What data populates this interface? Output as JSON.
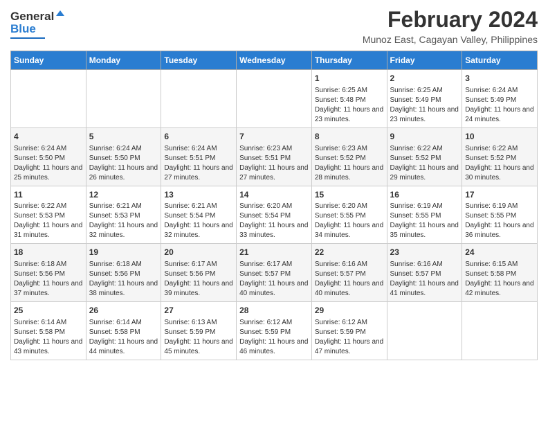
{
  "logo": {
    "general": "General",
    "blue": "Blue"
  },
  "title": "February 2024",
  "subtitle": "Munoz East, Cagayan Valley, Philippines",
  "headers": [
    "Sunday",
    "Monday",
    "Tuesday",
    "Wednesday",
    "Thursday",
    "Friday",
    "Saturday"
  ],
  "weeks": [
    [
      {
        "day": "",
        "detail": ""
      },
      {
        "day": "",
        "detail": ""
      },
      {
        "day": "",
        "detail": ""
      },
      {
        "day": "",
        "detail": ""
      },
      {
        "day": "1",
        "detail": "Sunrise: 6:25 AM\nSunset: 5:48 PM\nDaylight: 11 hours and 23 minutes."
      },
      {
        "day": "2",
        "detail": "Sunrise: 6:25 AM\nSunset: 5:49 PM\nDaylight: 11 hours and 23 minutes."
      },
      {
        "day": "3",
        "detail": "Sunrise: 6:24 AM\nSunset: 5:49 PM\nDaylight: 11 hours and 24 minutes."
      }
    ],
    [
      {
        "day": "4",
        "detail": "Sunrise: 6:24 AM\nSunset: 5:50 PM\nDaylight: 11 hours and 25 minutes."
      },
      {
        "day": "5",
        "detail": "Sunrise: 6:24 AM\nSunset: 5:50 PM\nDaylight: 11 hours and 26 minutes."
      },
      {
        "day": "6",
        "detail": "Sunrise: 6:24 AM\nSunset: 5:51 PM\nDaylight: 11 hours and 27 minutes."
      },
      {
        "day": "7",
        "detail": "Sunrise: 6:23 AM\nSunset: 5:51 PM\nDaylight: 11 hours and 27 minutes."
      },
      {
        "day": "8",
        "detail": "Sunrise: 6:23 AM\nSunset: 5:52 PM\nDaylight: 11 hours and 28 minutes."
      },
      {
        "day": "9",
        "detail": "Sunrise: 6:22 AM\nSunset: 5:52 PM\nDaylight: 11 hours and 29 minutes."
      },
      {
        "day": "10",
        "detail": "Sunrise: 6:22 AM\nSunset: 5:52 PM\nDaylight: 11 hours and 30 minutes."
      }
    ],
    [
      {
        "day": "11",
        "detail": "Sunrise: 6:22 AM\nSunset: 5:53 PM\nDaylight: 11 hours and 31 minutes."
      },
      {
        "day": "12",
        "detail": "Sunrise: 6:21 AM\nSunset: 5:53 PM\nDaylight: 11 hours and 32 minutes."
      },
      {
        "day": "13",
        "detail": "Sunrise: 6:21 AM\nSunset: 5:54 PM\nDaylight: 11 hours and 32 minutes."
      },
      {
        "day": "14",
        "detail": "Sunrise: 6:20 AM\nSunset: 5:54 PM\nDaylight: 11 hours and 33 minutes."
      },
      {
        "day": "15",
        "detail": "Sunrise: 6:20 AM\nSunset: 5:55 PM\nDaylight: 11 hours and 34 minutes."
      },
      {
        "day": "16",
        "detail": "Sunrise: 6:19 AM\nSunset: 5:55 PM\nDaylight: 11 hours and 35 minutes."
      },
      {
        "day": "17",
        "detail": "Sunrise: 6:19 AM\nSunset: 5:55 PM\nDaylight: 11 hours and 36 minutes."
      }
    ],
    [
      {
        "day": "18",
        "detail": "Sunrise: 6:18 AM\nSunset: 5:56 PM\nDaylight: 11 hours and 37 minutes."
      },
      {
        "day": "19",
        "detail": "Sunrise: 6:18 AM\nSunset: 5:56 PM\nDaylight: 11 hours and 38 minutes."
      },
      {
        "day": "20",
        "detail": "Sunrise: 6:17 AM\nSunset: 5:56 PM\nDaylight: 11 hours and 39 minutes."
      },
      {
        "day": "21",
        "detail": "Sunrise: 6:17 AM\nSunset: 5:57 PM\nDaylight: 11 hours and 40 minutes."
      },
      {
        "day": "22",
        "detail": "Sunrise: 6:16 AM\nSunset: 5:57 PM\nDaylight: 11 hours and 40 minutes."
      },
      {
        "day": "23",
        "detail": "Sunrise: 6:16 AM\nSunset: 5:57 PM\nDaylight: 11 hours and 41 minutes."
      },
      {
        "day": "24",
        "detail": "Sunrise: 6:15 AM\nSunset: 5:58 PM\nDaylight: 11 hours and 42 minutes."
      }
    ],
    [
      {
        "day": "25",
        "detail": "Sunrise: 6:14 AM\nSunset: 5:58 PM\nDaylight: 11 hours and 43 minutes."
      },
      {
        "day": "26",
        "detail": "Sunrise: 6:14 AM\nSunset: 5:58 PM\nDaylight: 11 hours and 44 minutes."
      },
      {
        "day": "27",
        "detail": "Sunrise: 6:13 AM\nSunset: 5:59 PM\nDaylight: 11 hours and 45 minutes."
      },
      {
        "day": "28",
        "detail": "Sunrise: 6:12 AM\nSunset: 5:59 PM\nDaylight: 11 hours and 46 minutes."
      },
      {
        "day": "29",
        "detail": "Sunrise: 6:12 AM\nSunset: 5:59 PM\nDaylight: 11 hours and 47 minutes."
      },
      {
        "day": "",
        "detail": ""
      },
      {
        "day": "",
        "detail": ""
      }
    ]
  ]
}
